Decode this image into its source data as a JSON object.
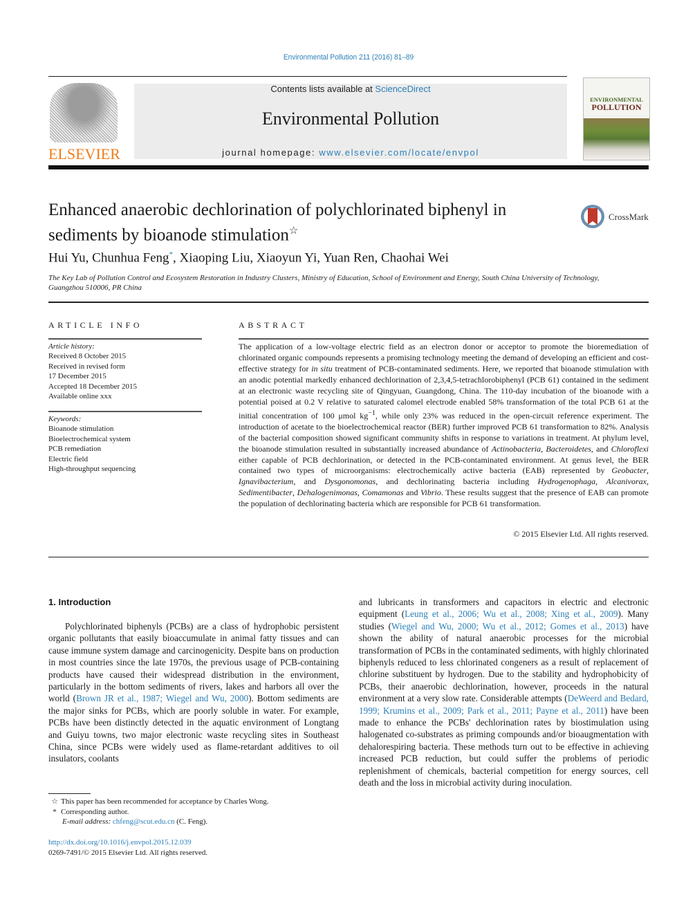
{
  "journal_ref": "Environmental Pollution 211 (2016) 81–89",
  "header": {
    "publisher_logo_text": "ELSEVIER",
    "contents_prefix": "Contents lists available at ",
    "contents_link": "ScienceDirect",
    "journal_title": "Environmental Pollution",
    "homepage_prefix": "journal homepage: ",
    "homepage_link": "www.elsevier.com/locate/envpol",
    "cover_line1": "ENVIRONMENTAL",
    "cover_line2": "POLLUTION",
    "crossmark_label": "CrossMark"
  },
  "article": {
    "title": "Enhanced anaerobic dechlorination of polychlorinated biphenyl in sediments by bioanode stimulation",
    "title_mark": "☆",
    "authors_before": "Hui Yu, Chunhua Feng",
    "author_mark": "*",
    "authors_after": ", Xiaoping Liu, Xiaoyun Yi, Yuan Ren, Chaohai Wei",
    "affiliation": "The Key Lab of Pollution Control and Ecosystem Restoration in Industry Clusters, Ministry of Education, School of Environment and Energy, South China University of Technology, Guangzhou 510006, PR China"
  },
  "article_info": {
    "heading": "ARTICLE INFO",
    "history_label": "Article history:",
    "history": [
      "Received 8 October 2015",
      "Received in revised form",
      "17 December 2015",
      "Accepted 18 December 2015",
      "Available online xxx"
    ],
    "keywords_label": "Keywords:",
    "keywords": [
      "Bioanode stimulation",
      "Bioelectrochemical system",
      "PCB remediation",
      "Electric field",
      "High-throughput sequencing"
    ]
  },
  "abstract": {
    "heading": "ABSTRACT",
    "p1": "The application of a low-voltage electric field as an electron donor or acceptor to promote the bioremediation of chlorinated organic compounds represents a promising technology meeting the demand of developing an efficient and cost-effective strategy for ",
    "p1_italic": "in situ",
    "p2": " treatment of PCB-contaminated sediments. Here, we reported that bioanode stimulation with an anodic potential markedly enhanced dechlorination of 2,3,4,5-tetrachlorobiphenyl (PCB 61) contained in the sediment at an electronic waste recycling site of Qingyuan, Guangdong, China. The 110-day incubation of the bioanode with a potential poised at 0.2 V relative to saturated calomel electrode enabled 58% transformation of the total PCB 61 at the initial concentration of 100 μmol kg",
    "p2_sup": "−1",
    "p3": ", while only 23% was reduced in the open-circuit reference experiment. The introduction of acetate to the bioelectrochemical reactor (BER) further improved PCB 61 transformation to 82%. Analysis of the bacterial composition showed significant community shifts in response to variations in treatment. At phylum level, the bioanode stimulation resulted in substantially increased abundance of ",
    "taxa_phylum": [
      "Actinobacteria",
      "Bacteroidetes",
      "Chloroflexi"
    ],
    "p4": " either capable of PCB dechlorination, or detected in the PCB-contaminated environment. At genus level, the BER contained two types of microorganisms: electrochemically active bacteria (EAB) represented by ",
    "taxa_eab": [
      "Geobacter",
      "Ignavibacterium",
      "Dysgonomonas"
    ],
    "p5": ", and dechlorinating bacteria including ",
    "taxa_dechl": [
      "Hydrogenophaga",
      "Alcanivorax",
      "Sedimentibacter",
      "Dehalogenimonas",
      "Comamonas",
      "Vibrio"
    ],
    "p6": ". These results suggest that the presence of EAB can promote the population of dechlorinating bacteria which are responsible for PCB 61 transformation.",
    "copyright": "© 2015 Elsevier Ltd. All rights reserved."
  },
  "introduction": {
    "heading": "1.  Introduction",
    "left": [
      {
        "t": "Polychlorinated biphenyls (PCBs) are a class of hydrophobic persistent organic pollutants that easily bioaccumulate in animal fatty tissues and can cause immune system damage and carcinogenicity. Despite bans on production in most countries since the late 1970s, the previous usage of PCB-containing products have caused their widespread distribution in the environment, particularly in the bottom sediments of rivers, lakes and harbors all over the world ("
      },
      {
        "t": "Brown JR et al., 1987; Wiegel and Wu, 2000",
        "link": true
      },
      {
        "t": "). Bottom sediments are the major sinks for PCBs, which are poorly soluble in water. For example, PCBs have been distinctly detected in the aquatic environment of Longtang and Guiyu towns, two major electronic waste recycling sites in Southeast China, since PCBs were widely used as flame-retardant additives to oil insulators, coolants"
      }
    ],
    "right": [
      {
        "t": "and lubricants in transformers and capacitors in electric and electronic equipment ("
      },
      {
        "t": "Leung et al., 2006; Wu et al., 2008; Xing et al., 2009",
        "link": true
      },
      {
        "t": "). Many studies ("
      },
      {
        "t": "Wiegel and Wu, 2000; Wu et al., 2012; Gomes et al., 2013",
        "link": true
      },
      {
        "t": ") have shown the ability of natural anaerobic processes for the microbial transformation of PCBs in the contaminated sediments, with highly chlorinated biphenyls reduced to less chlorinated congeners as a result of replacement of chlorine substituent by hydrogen. Due to the stability and hydrophobicity of PCBs, their anaerobic dechlorination, however, proceeds in the natural environment at a very slow rate. Considerable attempts ("
      },
      {
        "t": "DeWeerd and Bedard, 1999; Krumins et al., 2009; Park et al., 2011; Payne et al., 2011",
        "link": true
      },
      {
        "t": ") have been made to enhance the PCBs' dechlorination rates by biostimulation using halogenated co-substrates as priming compounds and/or bioaugmentation with dehalorespiring bacteria. These methods turn out to be effective in achieving increased PCB reduction, but could suffer the problems of periodic replenishment of chemicals, bacterial competition for energy sources, cell death and the loss in microbial activity during inoculation."
      }
    ]
  },
  "footnotes": {
    "star_mark": "☆",
    "star_text": "This paper has been recommended for acceptance by Charles Wong.",
    "corr_mark": "*",
    "corr_text": "Corresponding author.",
    "email_label": "E-mail address: ",
    "email": "chfeng@scut.edu.cn",
    "email_suffix": " (C. Feng).",
    "doi": "http://dx.doi.org/10.1016/j.envpol.2015.12.039",
    "issn_copyright": "0269-7491/© 2015 Elsevier Ltd. All rights reserved."
  },
  "colors": {
    "link": "#2b7fb8",
    "elsevier_orange": "#f07d19",
    "banner_bg": "#ececec"
  }
}
